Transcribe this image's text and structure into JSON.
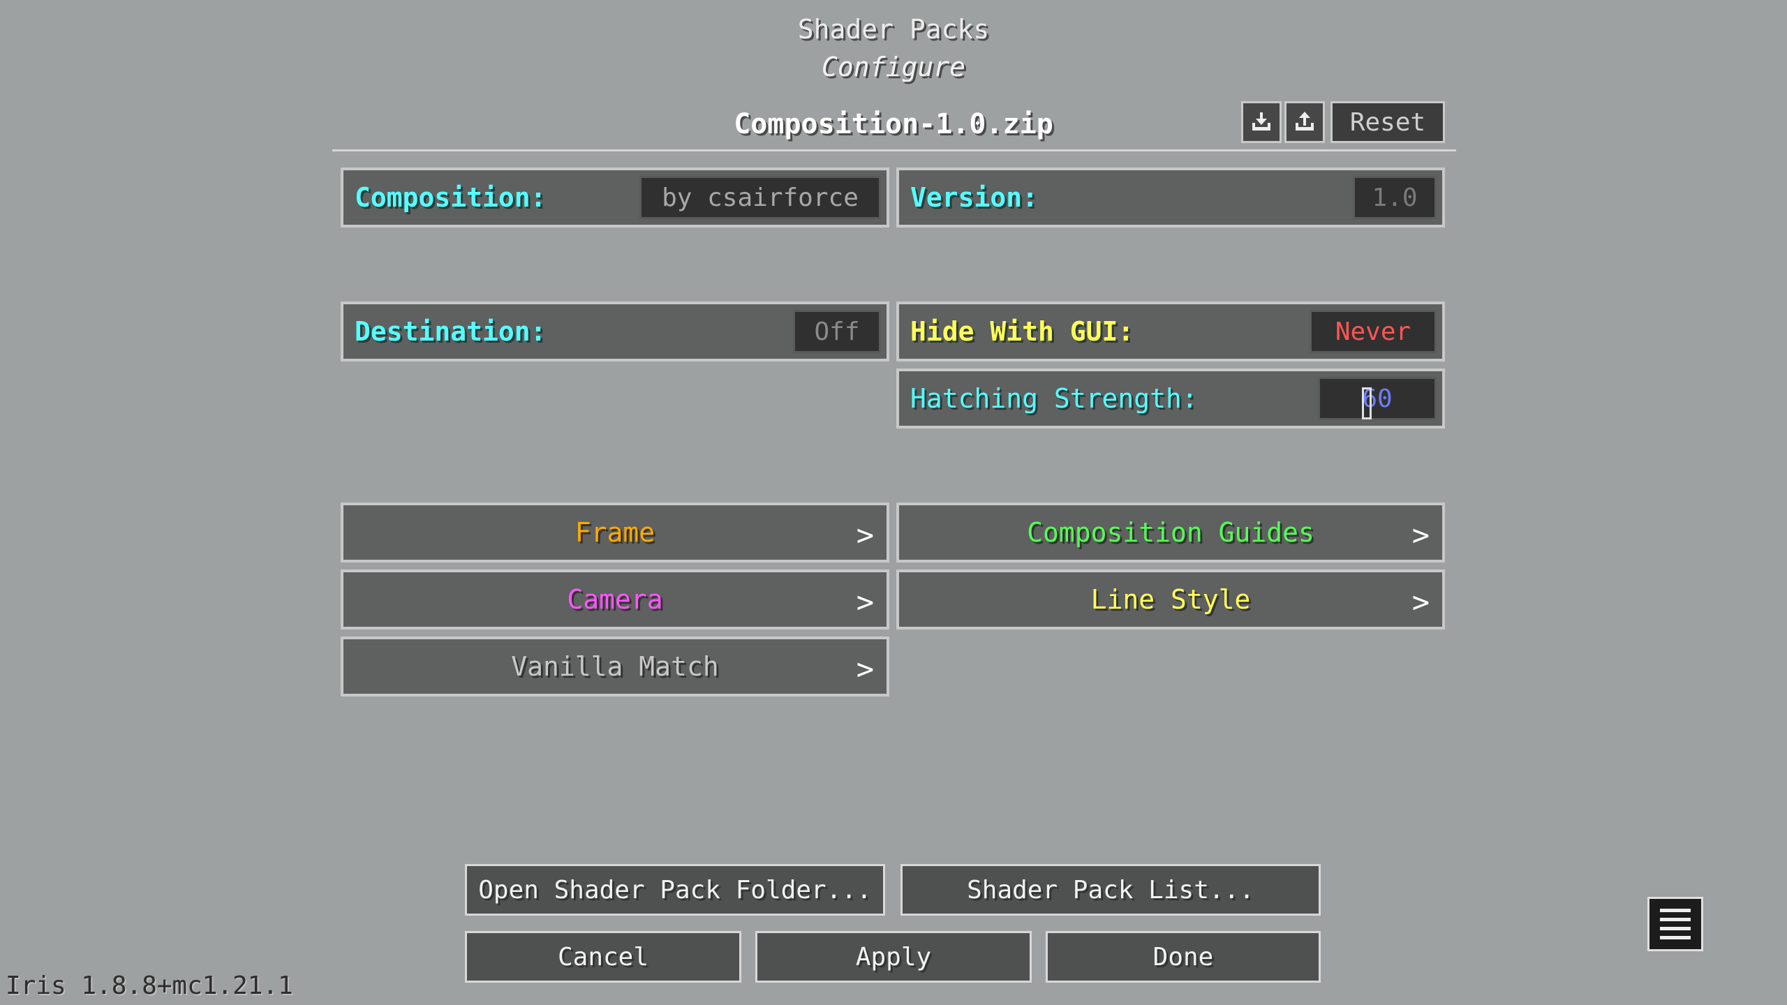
{
  "header": {
    "title": "Shader Packs",
    "subtitle": "Configure",
    "pack_name": "Composition-1.0.zip"
  },
  "toolbar": {
    "import_icon": "import-icon",
    "export_icon": "export-icon",
    "reset_label": "Reset"
  },
  "options": {
    "composition": {
      "label": "Composition:",
      "value": "by csairforce"
    },
    "version": {
      "label": "Version:",
      "value": "1.0"
    },
    "destination": {
      "label": "Destination:",
      "value": "Off"
    },
    "hide_with_gui": {
      "label": "Hide With GUI:",
      "value": "Never"
    },
    "hatching_strength": {
      "label": "Hatching Strength:",
      "value": "60"
    }
  },
  "menus": {
    "frame": {
      "label": "Frame",
      "color": "#ffaa00"
    },
    "composition_guides": {
      "label": "Composition Guides",
      "color": "#55ff55"
    },
    "camera": {
      "label": "Camera",
      "color": "#ff55ff"
    },
    "line_style": {
      "label": "Line Style",
      "color": "#ffff55"
    },
    "vanilla_match": {
      "label": "Vanilla Match",
      "color": "#c8c8c8"
    }
  },
  "bottom": {
    "open_folder": "Open Shader Pack Folder...",
    "pack_list": "Shader Pack List...",
    "cancel": "Cancel",
    "apply": "Apply",
    "done": "Done"
  },
  "footer": {
    "version_text": "Iris 1.8.8+mc1.21.1"
  }
}
